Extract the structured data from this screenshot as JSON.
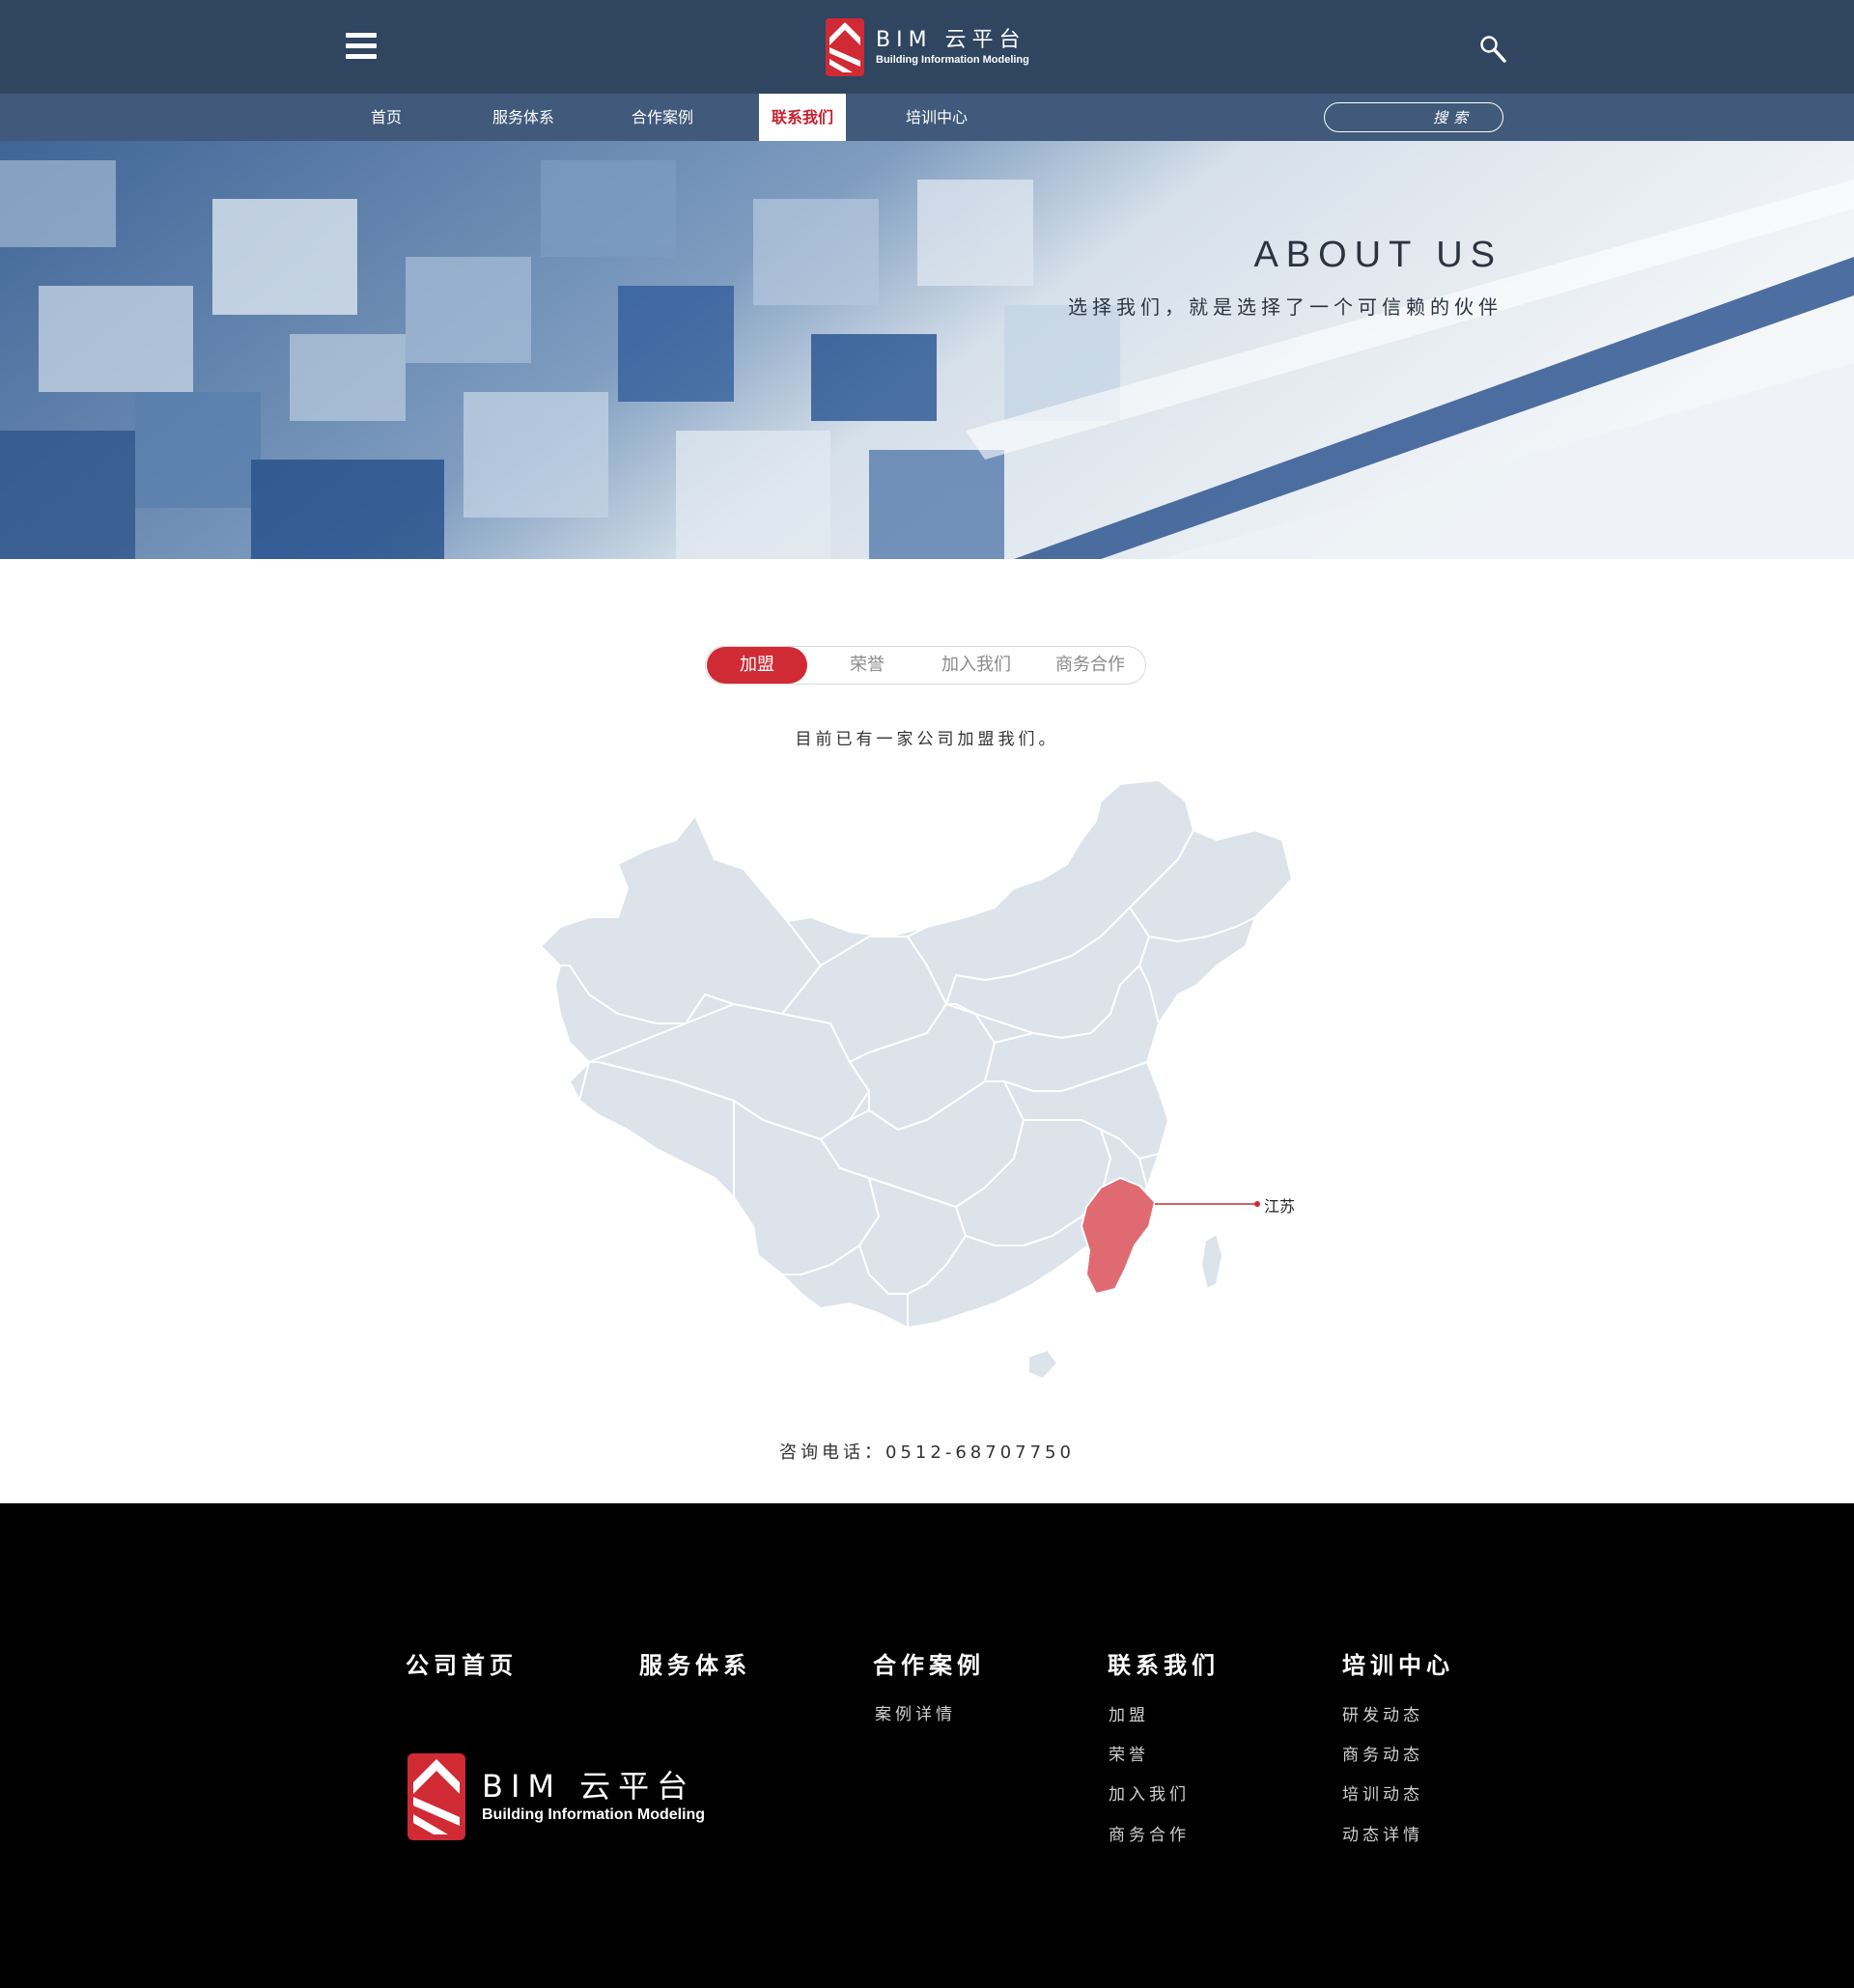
{
  "header": {
    "brand_name": "BIM 云平台",
    "brand_tagline": "Building Information Modeling"
  },
  "nav": {
    "items": [
      {
        "label": "首页"
      },
      {
        "label": "服务体系"
      },
      {
        "label": "合作案例"
      },
      {
        "label": "联系我们",
        "active": true
      },
      {
        "label": "培训中心"
      }
    ],
    "search_placeholder": "搜索"
  },
  "banner": {
    "title": "ABOUT  US",
    "subtitle": "选择我们，就是选择了一个可信赖的伙伴"
  },
  "tabs": [
    {
      "label": "加盟",
      "active": true
    },
    {
      "label": "荣誉"
    },
    {
      "label": "加入我们"
    },
    {
      "label": "商务合作"
    }
  ],
  "intro_text": "目前已有一家公司加盟我们。",
  "map": {
    "highlight_label": "江苏",
    "highlight_color": "#e06a72",
    "base_color": "#dce3ea"
  },
  "phone_text": "咨询电话：0512-68707750",
  "footer": {
    "columns": [
      {
        "heading": "公司首页",
        "links": []
      },
      {
        "heading": "服务体系",
        "links": []
      },
      {
        "heading": "合作案例",
        "links": [
          "案例详情"
        ]
      },
      {
        "heading": "联系我们",
        "links": [
          "加盟",
          "荣誉",
          "加入我们",
          "商务合作"
        ]
      },
      {
        "heading": "培训中心",
        "links": [
          "研发动态",
          "商务动态",
          "培训动态",
          "动态详情"
        ]
      }
    ],
    "brand_name": "BIM 云平台",
    "brand_tagline": "Building Information Modeling"
  },
  "colors": {
    "header_bg": "#2f4560",
    "nav_bg": "#41597a",
    "accent_red": "#d02a35",
    "footer_bg": "#000000"
  }
}
